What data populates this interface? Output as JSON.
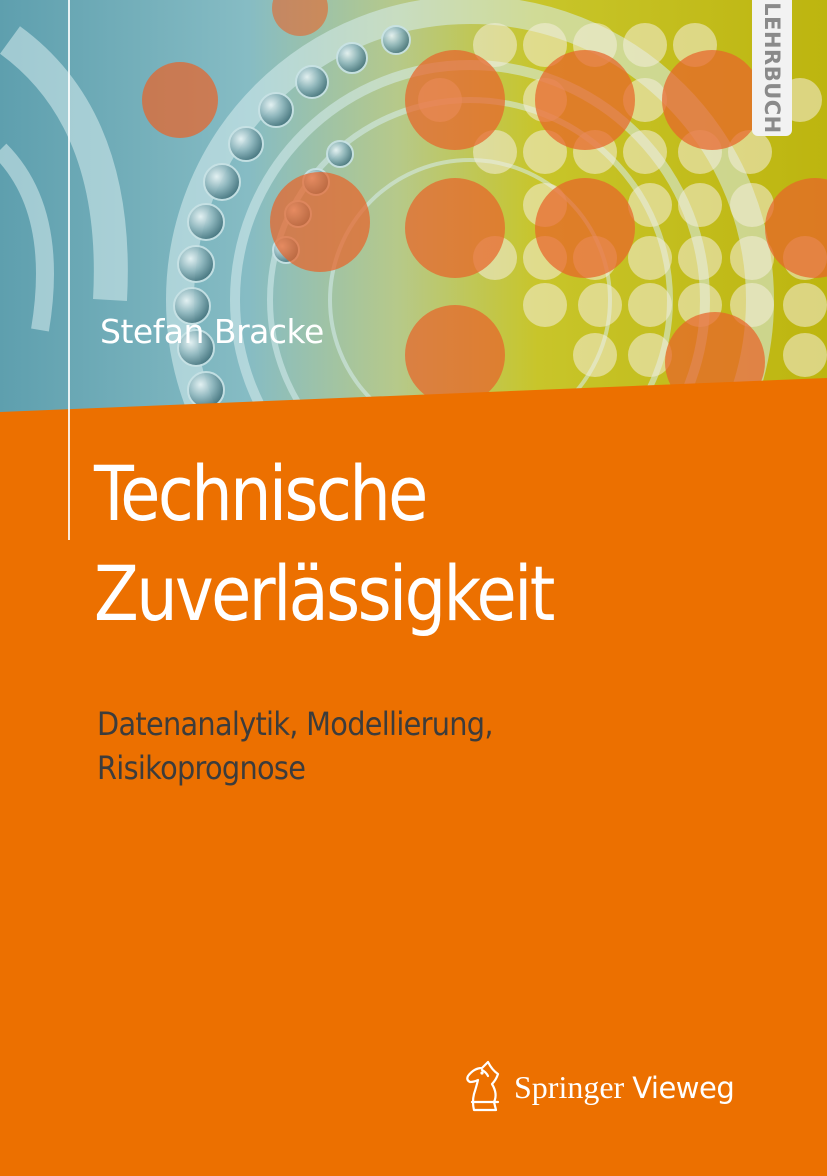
{
  "badge": {
    "label": "LEHRBUCH"
  },
  "author": "Stefan Bracke",
  "title": {
    "line1": "Technische",
    "line2": "Zuverlässigkeit"
  },
  "subtitle": {
    "line1": "Datenanalytik, Modellierung,",
    "line2": "Risikoprognose"
  },
  "publisher": {
    "name": "Springer",
    "imprint": "Vieweg",
    "logo_icon": "springer-horse-icon"
  },
  "colors": {
    "background": "#ec7000",
    "title_text": "#ffffff",
    "subtitle_text": "#3c3c3c",
    "badge_bg": "#f2f2f2"
  }
}
